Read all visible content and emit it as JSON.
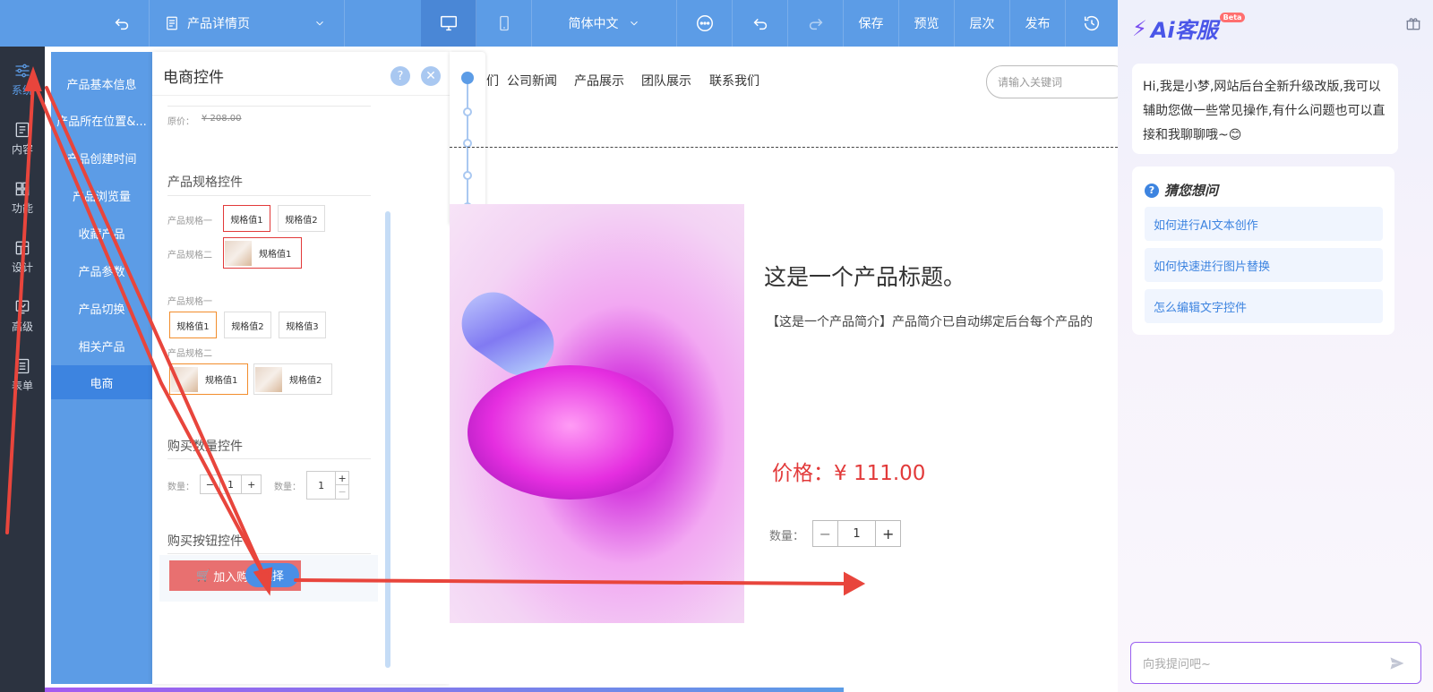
{
  "topbar": {
    "page_select": "产品详情页",
    "language": "简体中文",
    "save": "保存",
    "preview": "预览",
    "layers": "层次",
    "publish": "发布"
  },
  "leftnav": {
    "items": [
      {
        "label": "系统",
        "icon": "sliders-icon"
      },
      {
        "label": "内容",
        "icon": "document-icon"
      },
      {
        "label": "功能",
        "icon": "grid-icon"
      },
      {
        "label": "设计",
        "icon": "layout-icon"
      },
      {
        "label": "高级",
        "icon": "chart-icon"
      },
      {
        "label": "表单",
        "icon": "list-icon"
      }
    ]
  },
  "submenu": {
    "items": [
      "产品基本信息",
      "产品所在位置&...",
      "产品创建时间",
      "产品浏览量",
      "收藏产品",
      "产品参数",
      "产品切换",
      "相关产品",
      "电商"
    ]
  },
  "panel": {
    "title": "电商控件",
    "original_price_label": "原价：",
    "original_price": "¥ 208.00",
    "spec_section": "产品规格控件",
    "spec1_label": "产品规格一",
    "spec2_label": "产品规格二",
    "spec_value1": "规格值1",
    "spec_value2": "规格值2",
    "spec_value3": "规格值3",
    "qty_section": "购买数量控件",
    "qty_label": "数量：",
    "qty_value": "1",
    "buy_section": "购买按钮控件",
    "add_cart": "加入购",
    "select_badge": "选择"
  },
  "canvas": {
    "nav": [
      "们",
      "公司新闻",
      "产品展示",
      "团队展示",
      "联系我们"
    ],
    "search_placeholder": "请输入关键词",
    "product_title": "这是一个产品标题。",
    "product_intro": "【这是一个产品简介】产品简介已自动绑定后台每个产品的",
    "price": "价格：¥ 111.00",
    "qty_label": "数量：",
    "qty_value": "1"
  },
  "ai": {
    "brand": "Ai客服",
    "beta": "Beta",
    "greeting": "Hi,我是小梦,网站后台全新升级改版,我可以辅助您做一些常见操作,有什么问题也可以直接和我聊聊哦~😊",
    "guess_title": "猜您想问",
    "questions": [
      "如何进行AI文本创作",
      "如何快速进行图片替换",
      "怎么编辑文字控件"
    ],
    "input_placeholder": "向我提问吧~"
  },
  "colors": {
    "primary": "#5c9ce6",
    "accent_red": "#e23a3a",
    "dark_nav": "#2c3340"
  }
}
